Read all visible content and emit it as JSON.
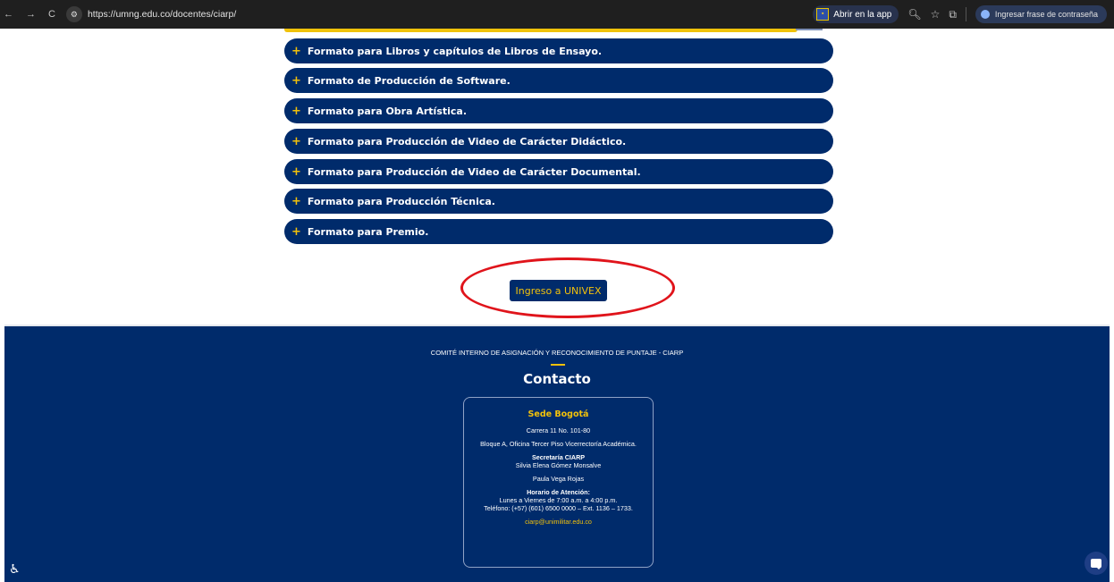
{
  "browser": {
    "url": "https://umng.edu.co/docentes/ciarp/",
    "open_in_app": "Abrir en la app",
    "password_pill": "Ingresar frase de contraseña"
  },
  "accordion": [
    "Formato para Libros y capítulos de Libros de Ensayo.",
    "Formato de Producción de Software.",
    "Formato para Obra Artística.",
    "Formato para Producción de Video de Carácter Didáctico.",
    "Formato para Producción de Video de Carácter Documental.",
    "Formato para Producción Técnica.",
    "Formato para Premio."
  ],
  "accordion_plus": "+",
  "cta": {
    "label": "Ingreso a UNIVEX"
  },
  "footer": {
    "comite": "COMITÉ INTERNO DE ASIGNACIÓN Y RECONOCIMIENTO DE PUNTAJE - CIARP",
    "title": "Contacto",
    "sede": "Sede Bogotá",
    "address1": "Carrera 11 No. 101-80",
    "address2": "Bloque A, Oficina Tercer Piso Vicerrectoría Académica.",
    "secretaria_label": "Secretaría CIARP",
    "secretaria_name1": "Silvia Elena Gómez Monsalve",
    "secretaria_name2": "Paula Vega Rojas",
    "horario_label": "Horario de Atención:",
    "horario": "Lunes a Viernes de 7:00 a.m. a 4:00 p.m.",
    "telefono": "Teléfono: (+57) (601) 6500 0000 – Ext. 1136 – 1733.",
    "email": "ciarp@unimilitar.edu.co"
  },
  "colors": {
    "navy": "#002b6b",
    "gold": "#f2c10b",
    "annotation": "#e0141b"
  }
}
